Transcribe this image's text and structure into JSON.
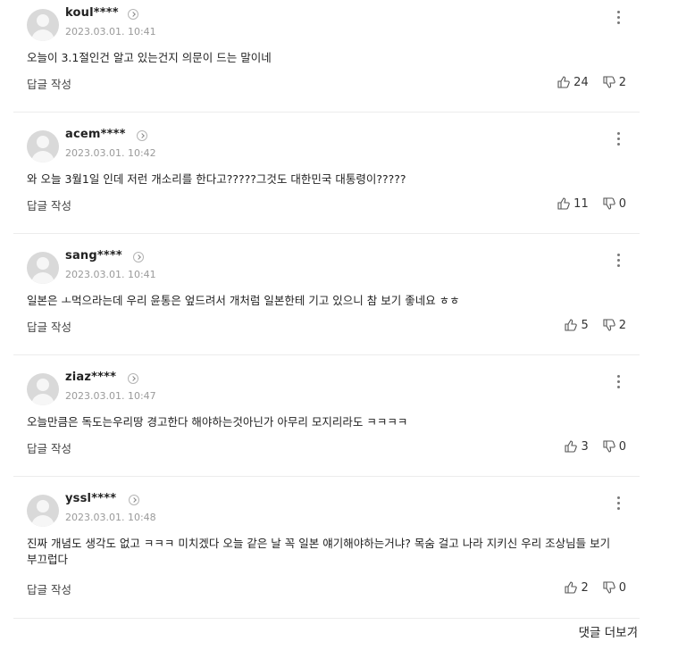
{
  "comments": [
    {
      "user": "koul****",
      "date": "2023.03.01. 10:41",
      "text": "오늘이 3.1절인건 알고 있는건지 의문이 드는 말이네",
      "reply": "답글 작성",
      "likes": "24",
      "dislikes": "2"
    },
    {
      "user": "acem****",
      "date": "2023.03.01. 10:42",
      "text": "와 오늘 3월1일 인데 저런 개소리를 한다고?????그것도 대한민국 대통령이?????",
      "reply": "답글 작성",
      "likes": "11",
      "dislikes": "0"
    },
    {
      "user": "sang****",
      "date": "2023.03.01. 10:41",
      "text": "일본은 ㅗ먹으라는데 우리 윤통은 엎드려서 개처럼 일본한테 기고 있으니 참 보기 좋네요 ㅎㅎ",
      "reply": "답글 작성",
      "likes": "5",
      "dislikes": "2"
    },
    {
      "user": "ziaz****",
      "date": "2023.03.01. 10:47",
      "text": "오늘만큼은 독도는우리땅 경고한다 해야하는것아닌가 아무리 모지리라도 ㅋㅋㅋㅋ",
      "reply": "답글 작성",
      "likes": "3",
      "dislikes": "0"
    },
    {
      "user": "yssl****",
      "date": "2023.03.01. 10:48",
      "text": "진짜 개념도 생각도 없고 ㅋㅋㅋ 미치겠다 오늘 같은 날 꼭 일본 얘기해야하는거냐? 목숨 걸고 나라 지키신 우리 조상님들 보기 부끄럽다",
      "reply": "답글 작성",
      "likes": "2",
      "dislikes": "0"
    }
  ],
  "more_comments_label": "댓글 더보기",
  "icons": {
    "like": "thumbs-up-icon",
    "dislike": "thumbs-down-icon",
    "menu": "more-vertical-icon",
    "profile_link": "chevron-circle-icon",
    "more": "chevron-right-icon"
  }
}
